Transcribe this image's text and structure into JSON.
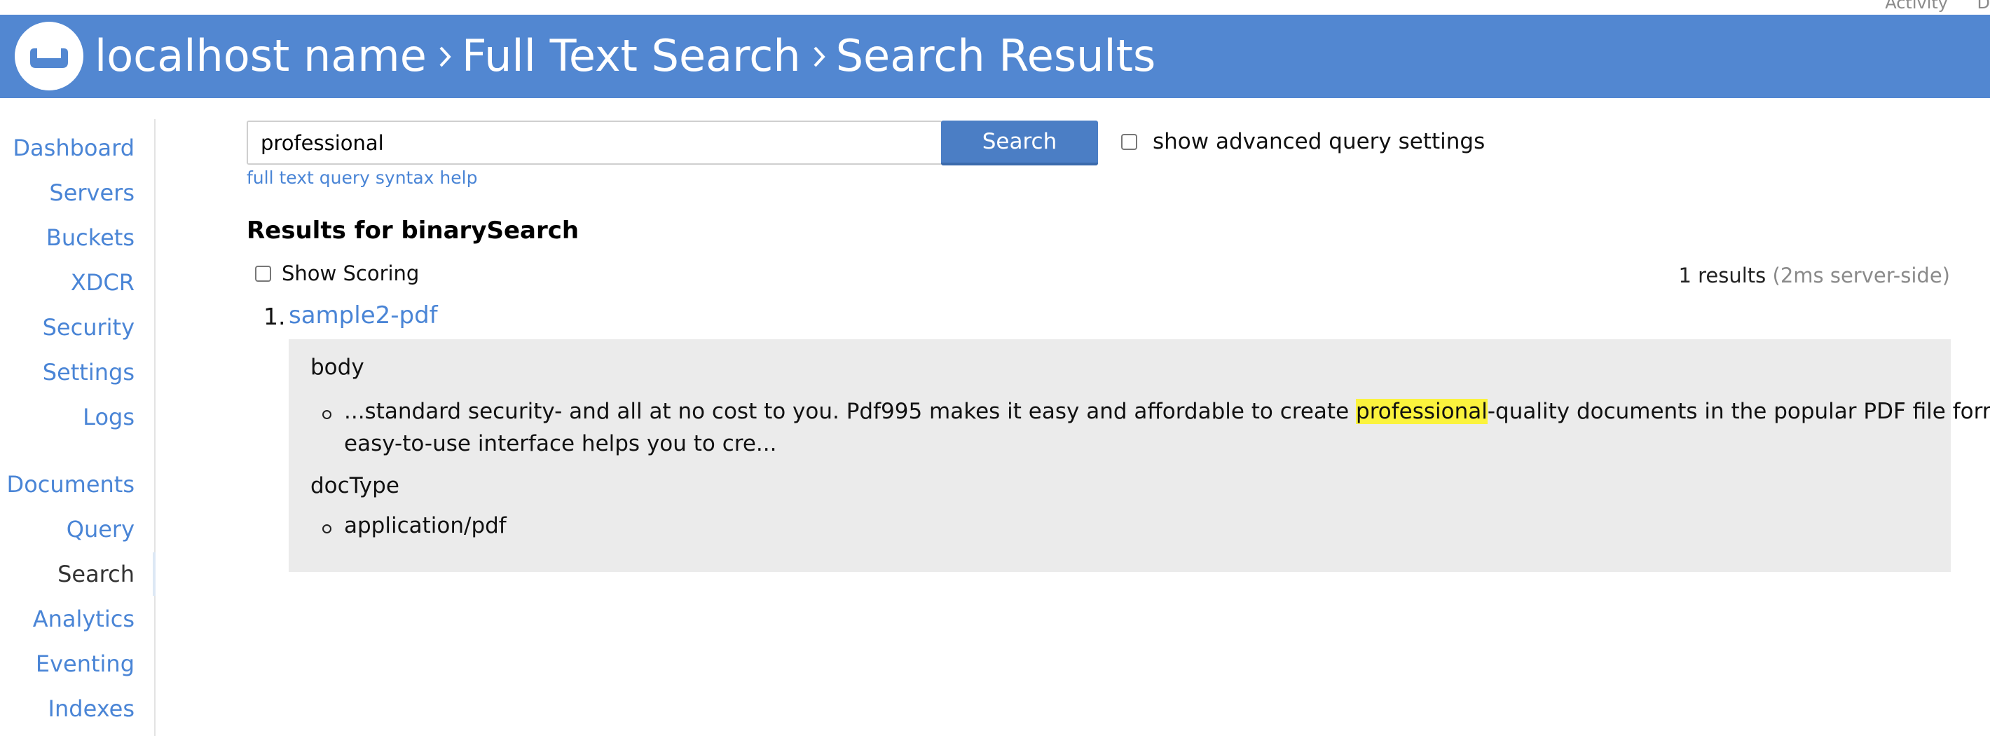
{
  "top_bar": {
    "activity_label": "Activity",
    "activity_trailing": "D"
  },
  "header": {
    "breadcrumb": [
      "localhost name",
      "Full Text Search",
      "Search Results"
    ],
    "background_color": "#5287d1"
  },
  "sidebar": {
    "items": [
      {
        "label": "Dashboard"
      },
      {
        "label": "Servers"
      },
      {
        "label": "Buckets"
      },
      {
        "label": "XDCR"
      },
      {
        "label": "Security"
      },
      {
        "label": "Settings"
      },
      {
        "label": "Logs"
      },
      {
        "label": "Documents"
      },
      {
        "label": "Query"
      },
      {
        "label": "Search",
        "active": true
      },
      {
        "label": "Analytics"
      },
      {
        "label": "Eventing"
      },
      {
        "label": "Indexes"
      }
    ]
  },
  "search": {
    "query_value": "professional",
    "button_label": "Search",
    "advanced_label": "show advanced query settings",
    "advanced_checked": false,
    "syntax_help_label": "full text query syntax help"
  },
  "results": {
    "heading": "Results for binarySearch",
    "show_scoring_label": "Show Scoring",
    "show_scoring_checked": false,
    "count_text": "1 results",
    "timing_text": "(2ms server-side)",
    "items": [
      {
        "number": "1.",
        "title": "sample2-pdf",
        "fields": [
          {
            "name": "body",
            "snippet_before": "...standard security- and all at no cost to you. Pdf995 makes it easy and affordable to create ",
            "snippet_highlight": "professional",
            "snippet_after": "-quality documents in the popular PDF file format. Its",
            "snippet_line2": "easy-to-use interface helps you to cre..."
          },
          {
            "name": "docType",
            "value": "application/pdf"
          }
        ]
      }
    ],
    "highlight_color": "#fbf33d"
  }
}
